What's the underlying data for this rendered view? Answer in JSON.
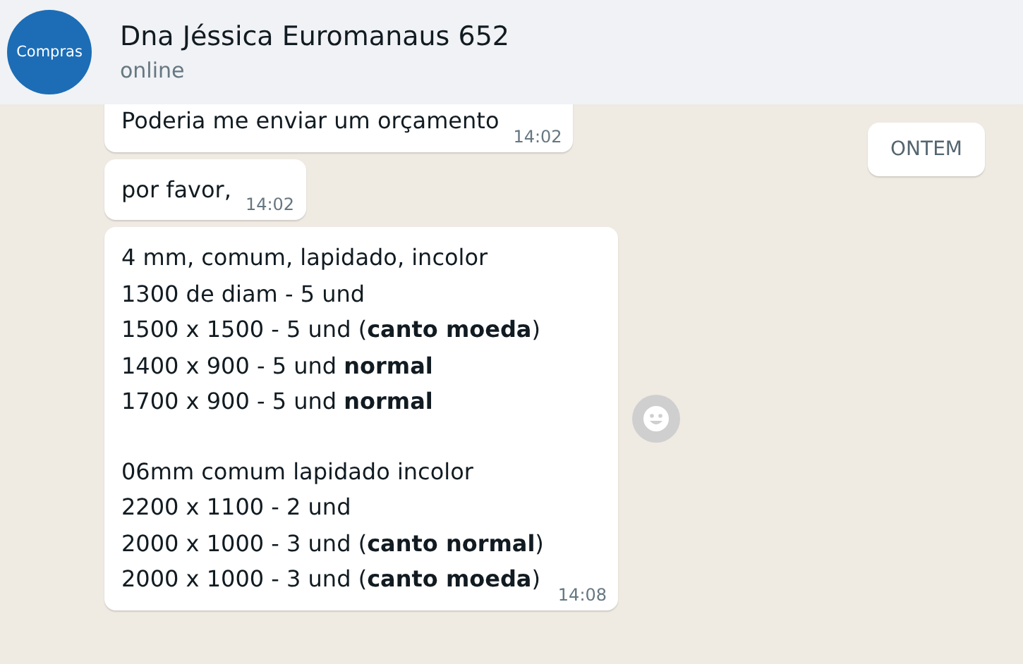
{
  "header": {
    "avatar_label": "Compras",
    "name": "Dna Jéssica Euromanaus 652",
    "status": "online"
  },
  "date_chip": "ONTEM",
  "messages": [
    {
      "paragraphs": [
        [
          "Poderia me enviar um orçamento"
        ]
      ],
      "time": "14:02",
      "clipped": true,
      "reaction_button": false
    },
    {
      "paragraphs": [
        [
          "por favor,"
        ]
      ],
      "time": "14:02",
      "clipped": false,
      "reaction_button": false
    },
    {
      "paragraphs": [
        [
          "4 mm, comum, lapidado, incolor",
          "1300 de diam - 5 und",
          "1500 x 1500 - 5 und (**canto moeda**)",
          "1400 x 900 - 5 und **normal**",
          "1700 x 900 - 5 und **normal**"
        ],
        [
          "06mm comum lapidado incolor",
          "2200 x 1100 - 2 und",
          "2000 x 1000 - 3 und (**canto normal**)",
          "2000 x 1000 - 3 und (**canto moeda**)"
        ]
      ],
      "time": "14:08",
      "clipped": false,
      "reaction_button": true
    }
  ]
}
